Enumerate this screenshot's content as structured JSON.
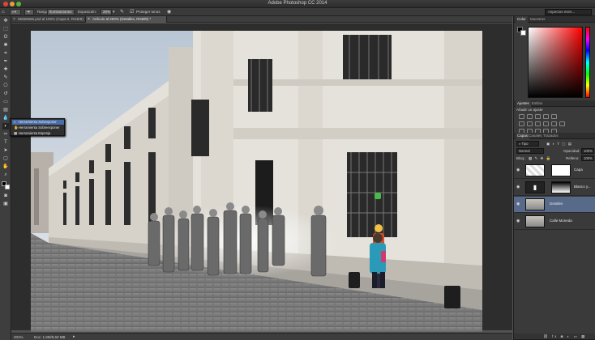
{
  "window": {
    "title": "Adobe Photoshop CC 2014"
  },
  "options_bar": {
    "range_label": "Rango:",
    "range_value": "Iluminaciones",
    "exposure_label": "Exposición:",
    "exposure_value": "20%",
    "protect_tones": "Proteger tonos",
    "workspace": "Aspectos esen..."
  },
  "tabs": [
    {
      "label": "06060686.psd al 100% (Capa 0, RGB/8) *"
    },
    {
      "label": "Artículo al 200% (Detalles, RGB/8) *"
    }
  ],
  "flyout": {
    "items": [
      {
        "label": "Herramienta Subexponer"
      },
      {
        "label": "Herramienta Sobreexponer"
      },
      {
        "label": "Herramienta Esponja"
      }
    ]
  },
  "status": {
    "zoom": "201%",
    "doc": "Doc: 1,9M/8,60 MB"
  },
  "color_panel": {
    "tabs": [
      "Color",
      "Muestras"
    ],
    "fg_color": "#ff1b2d",
    "bg_color": "#ffffff"
  },
  "adjust_panel": {
    "tabs": [
      "Ajustes",
      "Estilos"
    ],
    "title": "Añadir un ajuste"
  },
  "layers_panel": {
    "tabs": [
      "Capas",
      "Canales",
      "Trazados"
    ],
    "filter": "Tipo",
    "blend_mode": "Normal",
    "opacity_label": "Opacidad:",
    "opacity_value": "100%",
    "lock_label": "Bloq.:",
    "fill_label": "Relleno:",
    "fill_value": "100%",
    "layers": [
      {
        "name": "Capa",
        "selected": false
      },
      {
        "name": "Blanco y...",
        "selected": false
      },
      {
        "name": "Detalles",
        "selected": true
      },
      {
        "name": "Calle Moneda",
        "selected": false
      }
    ]
  }
}
